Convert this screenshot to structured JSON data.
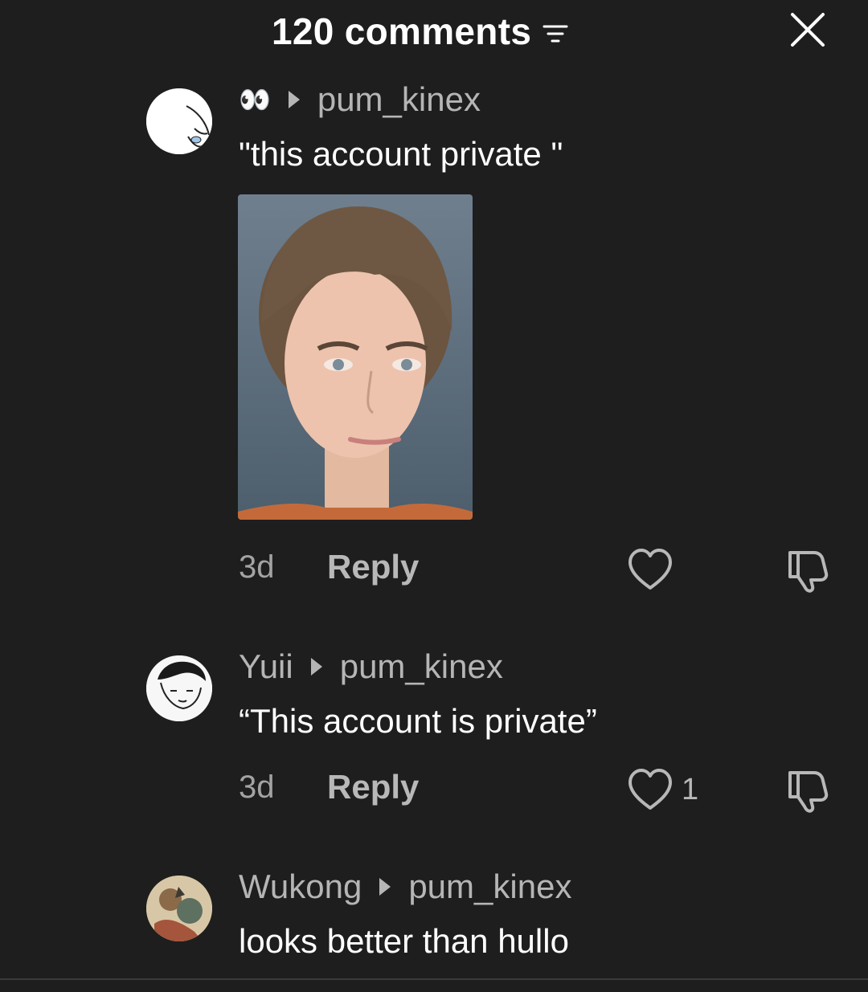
{
  "header": {
    "title": "120 comments",
    "filter_icon": "sort-lines-icon",
    "close_icon": "close-icon"
  },
  "comments": [
    {
      "author": "👀",
      "reply_to": "pum_kinex",
      "text": "\"this account private \"",
      "has_image": true,
      "time": "3d",
      "reply_label": "Reply",
      "likes": ""
    },
    {
      "author": "Yuii",
      "reply_to": "pum_kinex",
      "text": "“This account is private”",
      "has_image": false,
      "time": "3d",
      "reply_label": "Reply",
      "likes": "1"
    },
    {
      "author": "Wukong",
      "reply_to": "pum_kinex",
      "text": "looks better than hullo",
      "has_image": false
    }
  ],
  "colors": {
    "background": "#1e1e1e",
    "secondary_text": "#b5b5b5",
    "primary_text": "#ffffff"
  }
}
